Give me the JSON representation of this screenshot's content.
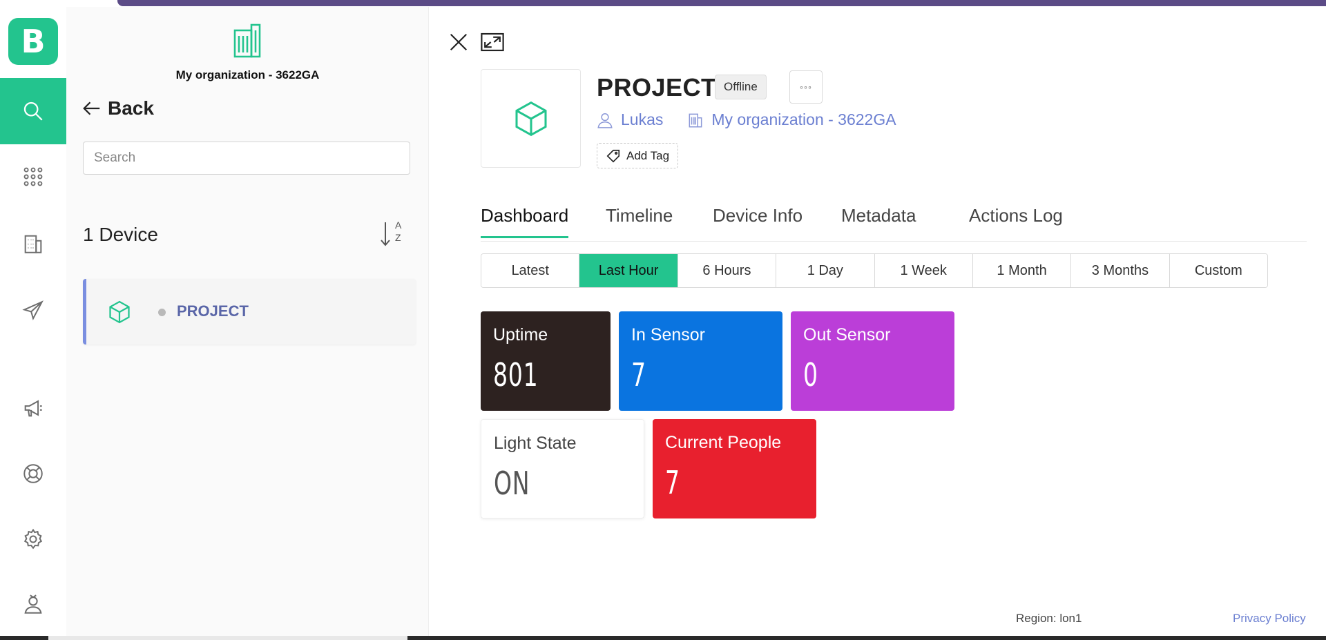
{
  "app": {
    "logo_letter": "B"
  },
  "sidebar": {
    "items": [
      {
        "id": "search",
        "icon": "search-icon",
        "active": true
      },
      {
        "id": "apps",
        "icon": "grid-icon",
        "active": false
      },
      {
        "id": "organizations",
        "icon": "building-icon",
        "active": false
      },
      {
        "id": "send",
        "icon": "paper-plane-icon",
        "active": false
      },
      {
        "id": "announcements",
        "icon": "megaphone-icon",
        "active": false
      },
      {
        "id": "help",
        "icon": "lifebuoy-icon",
        "active": false
      },
      {
        "id": "settings",
        "icon": "gear-icon",
        "active": false
      },
      {
        "id": "account",
        "icon": "user-badge-icon",
        "active": false
      }
    ]
  },
  "panel": {
    "org_name": "My organization - 3622GA",
    "back_label": "Back",
    "search_placeholder": "Search",
    "device_count": "1 Device",
    "sort_letters": [
      "A",
      "Z"
    ],
    "devices": [
      {
        "name": "PROJECT",
        "status": "offline"
      }
    ]
  },
  "device": {
    "title": "PROJECT",
    "status_badge": "Offline",
    "owner": "Lukas",
    "organization": "My organization - 3622GA",
    "add_tag_label": "Add Tag",
    "accent_color": "#23c48e"
  },
  "tabs": [
    {
      "label": "Dashboard",
      "active": true
    },
    {
      "label": "Timeline",
      "active": false
    },
    {
      "label": "Device Info",
      "active": false
    },
    {
      "label": "Metadata",
      "active": false
    },
    {
      "label": "Actions Log",
      "active": false
    }
  ],
  "time_ranges": [
    {
      "label": "Latest",
      "active": false
    },
    {
      "label": "Last Hour",
      "active": true
    },
    {
      "label": "6 Hours",
      "active": false
    },
    {
      "label": "1 Day",
      "active": false
    },
    {
      "label": "1 Week",
      "active": false
    },
    {
      "label": "1 Month",
      "active": false
    },
    {
      "label": "3 Months",
      "active": false
    },
    {
      "label": "Custom",
      "active": false
    }
  ],
  "widgets": [
    {
      "label": "Uptime",
      "value": "801",
      "color": "#2d2220"
    },
    {
      "label": "In Sensor",
      "value": "7",
      "color": "#0a74e0"
    },
    {
      "label": "Out Sensor",
      "value": "0",
      "color": "#bb3ed8"
    },
    {
      "label": "Light State",
      "value": "ON",
      "color": "#ffffff"
    },
    {
      "label": "Current People",
      "value": "7",
      "color": "#e8202e"
    }
  ],
  "footer": {
    "region": "Region: lon1",
    "privacy": "Privacy Policy"
  }
}
